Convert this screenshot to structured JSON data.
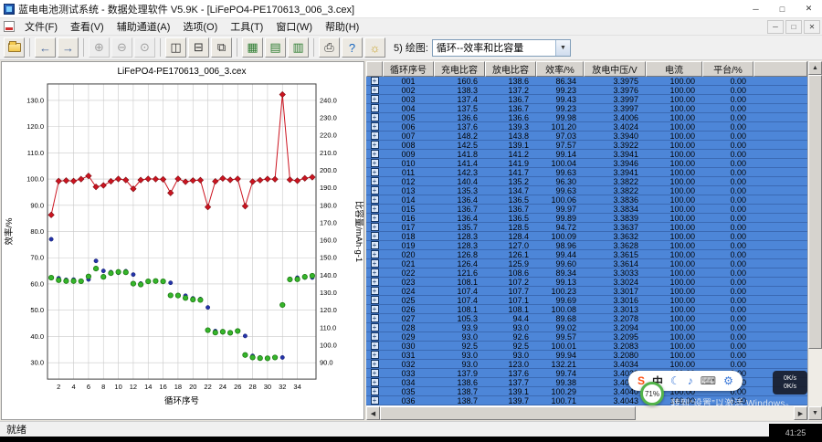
{
  "window": {
    "title": "蓝电电池测试系统 - 数据处理软件 V5.9K - [LiFePO4-PE170613_006_3.cex]",
    "controls": {
      "minimize": "─",
      "maximize": "□",
      "close": "✕"
    },
    "child_controls": {
      "minimize": "─",
      "restore": "□",
      "close": "✕"
    }
  },
  "menu": {
    "items": [
      {
        "id": "file",
        "label": "文件(F)"
      },
      {
        "id": "view",
        "label": "查看(V)"
      },
      {
        "id": "aux-channel",
        "label": "辅助通道(A)"
      },
      {
        "id": "options",
        "label": "选项(O)"
      },
      {
        "id": "tools",
        "label": "工具(T)"
      },
      {
        "id": "window",
        "label": "窗口(W)"
      },
      {
        "id": "help",
        "label": "帮助(H)"
      }
    ]
  },
  "toolbar": {
    "buttons": [
      {
        "id": "open-file",
        "shape": "folder",
        "enabled": true
      },
      {
        "sep": true
      },
      {
        "id": "back",
        "glyph": "←",
        "enabled": true,
        "color": "#46689f"
      },
      {
        "id": "forward",
        "glyph": "→",
        "enabled": true,
        "color": "#46689f"
      },
      {
        "sep": true
      },
      {
        "id": "zoom-in",
        "glyph": "⊕",
        "enabled": false
      },
      {
        "id": "zoom-out",
        "glyph": "⊖",
        "enabled": false
      },
      {
        "id": "zoom-reset",
        "glyph": "⊙",
        "enabled": false
      },
      {
        "sep": true
      },
      {
        "id": "tile-horizontal",
        "glyph": "◫",
        "enabled": true
      },
      {
        "id": "tile-vertical",
        "glyph": "⊟",
        "enabled": true
      },
      {
        "id": "cascade-windows",
        "glyph": "⧉",
        "enabled": true
      },
      {
        "sep": true
      },
      {
        "id": "data-grid",
        "glyph": "▦",
        "enabled": true,
        "color": "#2e7d32"
      },
      {
        "id": "data-list",
        "glyph": "▤",
        "enabled": true,
        "color": "#2e7d32"
      },
      {
        "id": "data-export",
        "glyph": "▥",
        "enabled": true,
        "color": "#2e7d32"
      },
      {
        "sep": true
      },
      {
        "id": "print",
        "glyph": "⎙",
        "enabled": true
      },
      {
        "id": "help",
        "glyph": "?",
        "enabled": true,
        "color": "#1565c0"
      },
      {
        "id": "tip-of-day",
        "glyph": "☼",
        "enabled": true,
        "color": "#c9a227"
      }
    ],
    "plot_label": "5) 绘图:",
    "plot_selector": "循环--效率和比容量",
    "combo_arrow": "▼"
  },
  "chart_data": {
    "type": "line",
    "title": "LiFePO4-PE170613_006_3.cex",
    "xlabel": "循环序号",
    "ylabel_left": "效率/%",
    "ylabel_right": "比容量/mAh·g-1",
    "x": [
      1,
      2,
      3,
      4,
      5,
      6,
      7,
      8,
      9,
      10,
      11,
      12,
      13,
      14,
      15,
      16,
      17,
      18,
      19,
      20,
      21,
      22,
      23,
      24,
      25,
      26,
      27,
      28,
      29,
      30,
      31,
      32,
      33,
      34,
      35,
      36
    ],
    "xticks": [
      2,
      4,
      6,
      8,
      10,
      12,
      14,
      16,
      18,
      20,
      22,
      24,
      26,
      28,
      30,
      32,
      34
    ],
    "ylim_left": [
      30,
      130
    ],
    "ytick_step_left": 10,
    "ylim_right": [
      90,
      240
    ],
    "ytick_step_right": 10,
    "grid": true,
    "series": [
      {
        "name": "效率/%",
        "axis": "left",
        "color": "#cc1420",
        "edge": "#7a0a10",
        "marker": "diamond",
        "line": true,
        "values": [
          86.34,
          99.23,
          99.43,
          99.23,
          99.98,
          101.2,
          97.03,
          97.57,
          99.14,
          100.04,
          99.63,
          96.3,
          99.63,
          100.06,
          99.97,
          99.89,
          94.72,
          100.09,
          98.96,
          99.44,
          99.6,
          89.34,
          99.13,
          100.23,
          99.69,
          100.08,
          89.68,
          99.02,
          99.57,
          100.01,
          99.94,
          132.21,
          99.74,
          99.38,
          100.29,
          100.71
        ]
      },
      {
        "name": "充电比容量",
        "axis": "right",
        "color": "#2433a8",
        "edge": "#121a66",
        "marker": "dot",
        "line": false,
        "values": [
          160.6,
          138.3,
          137.4,
          137.5,
          136.6,
          137.6,
          148.2,
          142.5,
          141.8,
          141.4,
          142.3,
          140.4,
          135.3,
          136.4,
          136.7,
          136.4,
          135.7,
          128.3,
          128.3,
          126.8,
          126.4,
          121.6,
          108.1,
          107.4,
          107.4,
          108.1,
          105.3,
          93.9,
          93.0,
          92.5,
          93.0,
          93.0,
          137.9,
          138.6,
          138.7,
          138.7
        ]
      },
      {
        "name": "放电比容量",
        "axis": "right",
        "color": "#35b52a",
        "edge": "#1d7a14",
        "marker": "circle",
        "line": false,
        "values": [
          138.6,
          137.2,
          136.7,
          136.7,
          136.6,
          139.3,
          143.8,
          139.1,
          141.2,
          141.9,
          141.7,
          135.2,
          134.7,
          136.5,
          136.7,
          136.5,
          128.5,
          128.4,
          127.0,
          126.1,
          125.9,
          108.6,
          107.2,
          107.7,
          107.1,
          108.1,
          94.4,
          93.0,
          92.6,
          92.5,
          93.0,
          123.0,
          137.6,
          137.7,
          139.1,
          139.7
        ]
      }
    ]
  },
  "table": {
    "headers": [
      "",
      "循环序号",
      "充电比容",
      "放电比容",
      "效率/%",
      "放电中压/V",
      "电流",
      "平台/%"
    ],
    "expander_glyph": "+",
    "rows": [
      [
        "001",
        "160.6",
        "138.6",
        "86.34",
        "3.3975",
        "100.00",
        "0.00"
      ],
      [
        "002",
        "138.3",
        "137.2",
        "99.23",
        "3.3976",
        "100.00",
        "0.00"
      ],
      [
        "003",
        "137.4",
        "136.7",
        "99.43",
        "3.3997",
        "100.00",
        "0.00"
      ],
      [
        "004",
        "137.5",
        "136.7",
        "99.23",
        "3.3997",
        "100.00",
        "0.00"
      ],
      [
        "005",
        "136.6",
        "136.6",
        "99.98",
        "3.4006",
        "100.00",
        "0.00"
      ],
      [
        "006",
        "137.6",
        "139.3",
        "101.20",
        "3.4024",
        "100.00",
        "0.00"
      ],
      [
        "007",
        "148.2",
        "143.8",
        "97.03",
        "3.3940",
        "100.00",
        "0.00"
      ],
      [
        "008",
        "142.5",
        "139.1",
        "97.57",
        "3.3922",
        "100.00",
        "0.00"
      ],
      [
        "009",
        "141.8",
        "141.2",
        "99.14",
        "3.3941",
        "100.00",
        "0.00"
      ],
      [
        "010",
        "141.4",
        "141.9",
        "100.04",
        "3.3946",
        "100.00",
        "0.00"
      ],
      [
        "011",
        "142.3",
        "141.7",
        "99.63",
        "3.3941",
        "100.00",
        "0.00"
      ],
      [
        "012",
        "140.4",
        "135.2",
        "96.30",
        "3.3822",
        "100.00",
        "0.00"
      ],
      [
        "013",
        "135.3",
        "134.7",
        "99.63",
        "3.3822",
        "100.00",
        "0.00"
      ],
      [
        "014",
        "136.4",
        "136.5",
        "100.06",
        "3.3836",
        "100.00",
        "0.00"
      ],
      [
        "015",
        "136.7",
        "136.7",
        "99.97",
        "3.3834",
        "100.00",
        "0.00"
      ],
      [
        "016",
        "136.4",
        "136.5",
        "99.89",
        "3.3839",
        "100.00",
        "0.00"
      ],
      [
        "017",
        "135.7",
        "128.5",
        "94.72",
        "3.3637",
        "100.00",
        "0.00"
      ],
      [
        "018",
        "128.3",
        "128.4",
        "100.09",
        "3.3632",
        "100.00",
        "0.00"
      ],
      [
        "019",
        "128.3",
        "127.0",
        "98.96",
        "3.3628",
        "100.00",
        "0.00"
      ],
      [
        "020",
        "126.8",
        "126.1",
        "99.44",
        "3.3615",
        "100.00",
        "0.00"
      ],
      [
        "021",
        "126.4",
        "125.9",
        "99.60",
        "3.3614",
        "100.00",
        "0.00"
      ],
      [
        "022",
        "121.6",
        "108.6",
        "89.34",
        "3.3033",
        "100.00",
        "0.00"
      ],
      [
        "023",
        "108.1",
        "107.2",
        "99.13",
        "3.3024",
        "100.00",
        "0.00"
      ],
      [
        "024",
        "107.4",
        "107.7",
        "100.23",
        "3.3017",
        "100.00",
        "0.00"
      ],
      [
        "025",
        "107.4",
        "107.1",
        "99.69",
        "3.3016",
        "100.00",
        "0.00"
      ],
      [
        "026",
        "108.1",
        "108.1",
        "100.08",
        "3.3013",
        "100.00",
        "0.00"
      ],
      [
        "027",
        "105.3",
        "94.4",
        "89.68",
        "3.2078",
        "100.00",
        "0.00"
      ],
      [
        "028",
        "93.9",
        "93.0",
        "99.02",
        "3.2094",
        "100.00",
        "0.00"
      ],
      [
        "029",
        "93.0",
        "92.6",
        "99.57",
        "3.2095",
        "100.00",
        "0.00"
      ],
      [
        "030",
        "92.5",
        "92.5",
        "100.01",
        "3.2083",
        "100.00",
        "0.00"
      ],
      [
        "031",
        "93.0",
        "93.0",
        "99.94",
        "3.2080",
        "100.00",
        "0.00"
      ],
      [
        "032",
        "93.0",
        "123.0",
        "132.21",
        "3.4034",
        "100.00",
        "0.00"
      ],
      [
        "033",
        "137.9",
        "137.6",
        "99.74",
        "3.4033",
        "100.00",
        "0.00"
      ],
      [
        "034",
        "138.6",
        "137.7",
        "99.38",
        "3.4033",
        "100.00",
        "0.00"
      ],
      [
        "035",
        "138.7",
        "139.1",
        "100.29",
        "3.4040",
        "100.00",
        "0.00"
      ],
      [
        "036",
        "138.7",
        "139.7",
        "100.71",
        "3.4043",
        "100.00",
        "0.00"
      ]
    ],
    "selection_color": "#4d86d8"
  },
  "statusbar": {
    "ready": "就绪"
  },
  "overlay": {
    "ime_icons": [
      {
        "id": "sogou-logo",
        "glyph": "S",
        "color": "#ff4f12"
      },
      {
        "id": "input-mode-chinese",
        "glyph": "中",
        "color": "#222222"
      },
      {
        "id": "night-mode",
        "glyph": "☾",
        "color": "#3b78d8"
      },
      {
        "id": "microphone",
        "glyph": "♪",
        "color": "#3b78d8"
      },
      {
        "id": "keyboard",
        "glyph": "⌨",
        "color": "#555555"
      },
      {
        "id": "toolbox",
        "glyph": "⚙",
        "color": "#3b78d8"
      }
    ],
    "battery_percent": "71%",
    "net_up": "0K/s",
    "net_down": "0K/s",
    "activation_hint": "转到“设置”以激活 Windows。",
    "timer": "41:25"
  }
}
